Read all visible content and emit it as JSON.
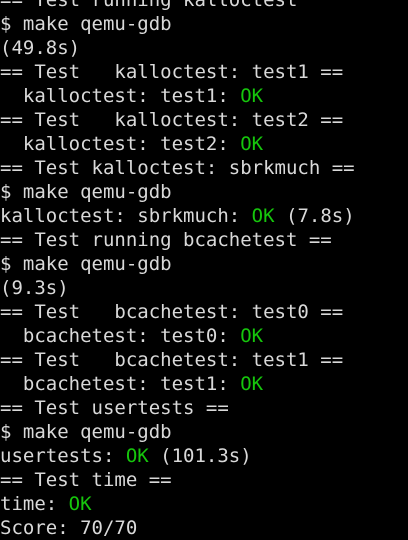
{
  "terminal": {
    "lines": [
      [
        {
          "text": "== Test running kalloctest"
        }
      ],
      [
        {
          "text": "$ make qemu-gdb"
        }
      ],
      [
        {
          "text": "(49.8s)"
        }
      ],
      [
        {
          "text": "== Test   kalloctest: test1 =="
        }
      ],
      [
        {
          "text": "  kalloctest: test1: "
        },
        {
          "text": "OK",
          "ok": true
        }
      ],
      [
        {
          "text": "== Test   kalloctest: test2 =="
        }
      ],
      [
        {
          "text": "  kalloctest: test2: "
        },
        {
          "text": "OK",
          "ok": true
        }
      ],
      [
        {
          "text": "== Test kalloctest: sbrkmuch =="
        }
      ],
      [
        {
          "text": "$ make qemu-gdb"
        }
      ],
      [
        {
          "text": "kalloctest: sbrkmuch: "
        },
        {
          "text": "OK",
          "ok": true
        },
        {
          "text": " (7.8s)"
        }
      ],
      [
        {
          "text": "== Test running bcachetest =="
        }
      ],
      [
        {
          "text": "$ make qemu-gdb"
        }
      ],
      [
        {
          "text": "(9.3s)"
        }
      ],
      [
        {
          "text": "== Test   bcachetest: test0 =="
        }
      ],
      [
        {
          "text": "  bcachetest: test0: "
        },
        {
          "text": "OK",
          "ok": true
        }
      ],
      [
        {
          "text": "== Test   bcachetest: test1 =="
        }
      ],
      [
        {
          "text": "  bcachetest: test1: "
        },
        {
          "text": "OK",
          "ok": true
        }
      ],
      [
        {
          "text": "== Test usertests =="
        }
      ],
      [
        {
          "text": "$ make qemu-gdb"
        }
      ],
      [
        {
          "text": "usertests: "
        },
        {
          "text": "OK",
          "ok": true
        },
        {
          "text": " (101.3s)"
        }
      ],
      [
        {
          "text": "== Test time =="
        }
      ],
      [
        {
          "text": "time: "
        },
        {
          "text": "OK",
          "ok": true
        }
      ],
      [
        {
          "text": "Score: 70/70"
        }
      ]
    ]
  },
  "colors": {
    "background": "#000000",
    "foreground": "#d9d9d9",
    "ok": "#16c60c"
  }
}
